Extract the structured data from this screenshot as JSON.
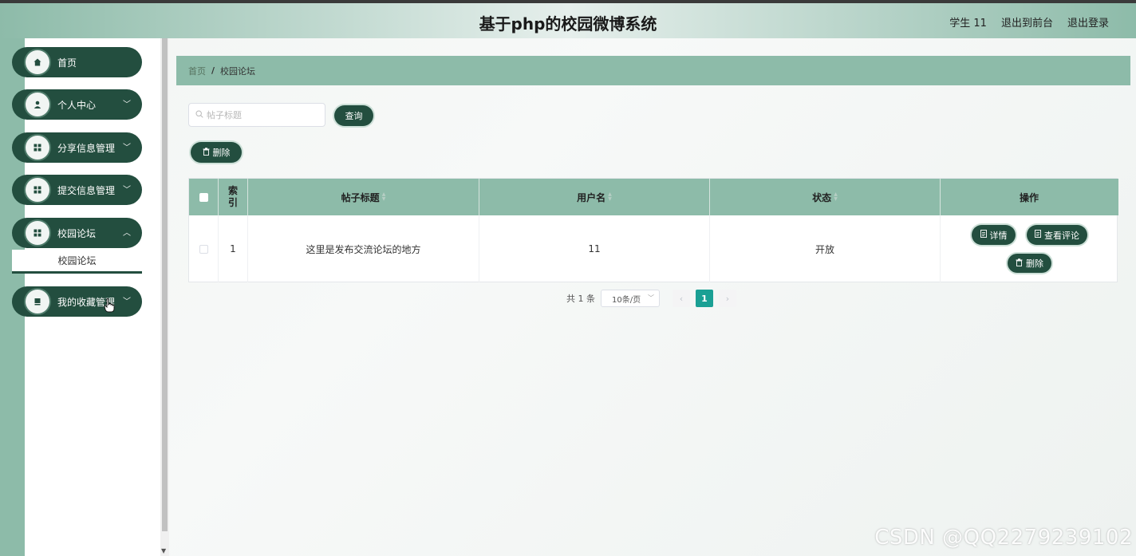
{
  "header": {
    "site_title": "基于php的校园微博系统",
    "user_label": "学生 11",
    "to_front": "退出到前台",
    "logout": "退出登录"
  },
  "sidebar": {
    "items": [
      {
        "label": "首页",
        "icon": "home-icon"
      },
      {
        "label": "个人中心",
        "icon": "user-icon"
      },
      {
        "label": "分享信息管理",
        "icon": "grid-icon"
      },
      {
        "label": "提交信息管理",
        "icon": "grid-icon"
      },
      {
        "label": "校园论坛",
        "icon": "grid-icon"
      },
      {
        "label": "我的收藏管理",
        "icon": "bookmark-icon"
      }
    ],
    "sub_item": "校园论坛"
  },
  "breadcrumb": {
    "home": "首页",
    "current": "校园论坛"
  },
  "search": {
    "placeholder": "帖子标题",
    "button": "查询"
  },
  "toolbar": {
    "delete": "删除"
  },
  "table": {
    "headers": {
      "index": "索引",
      "title": "帖子标题",
      "username": "用户名",
      "status": "状态",
      "actions": "操作"
    },
    "rows": [
      {
        "index": "1",
        "title": "这里是发布交流论坛的地方",
        "username": "11",
        "status": "开放"
      }
    ],
    "actions": {
      "detail": "详情",
      "view_comments": "查看评论",
      "delete": "删除"
    }
  },
  "pagination": {
    "total": "共 1 条",
    "page_size": "10条/页",
    "current": "1"
  },
  "watermark": "CSDN @QQ2279239102",
  "colors": {
    "primary": "#234e3f",
    "accent": "#8dbba9",
    "page_active": "#1aa094"
  }
}
